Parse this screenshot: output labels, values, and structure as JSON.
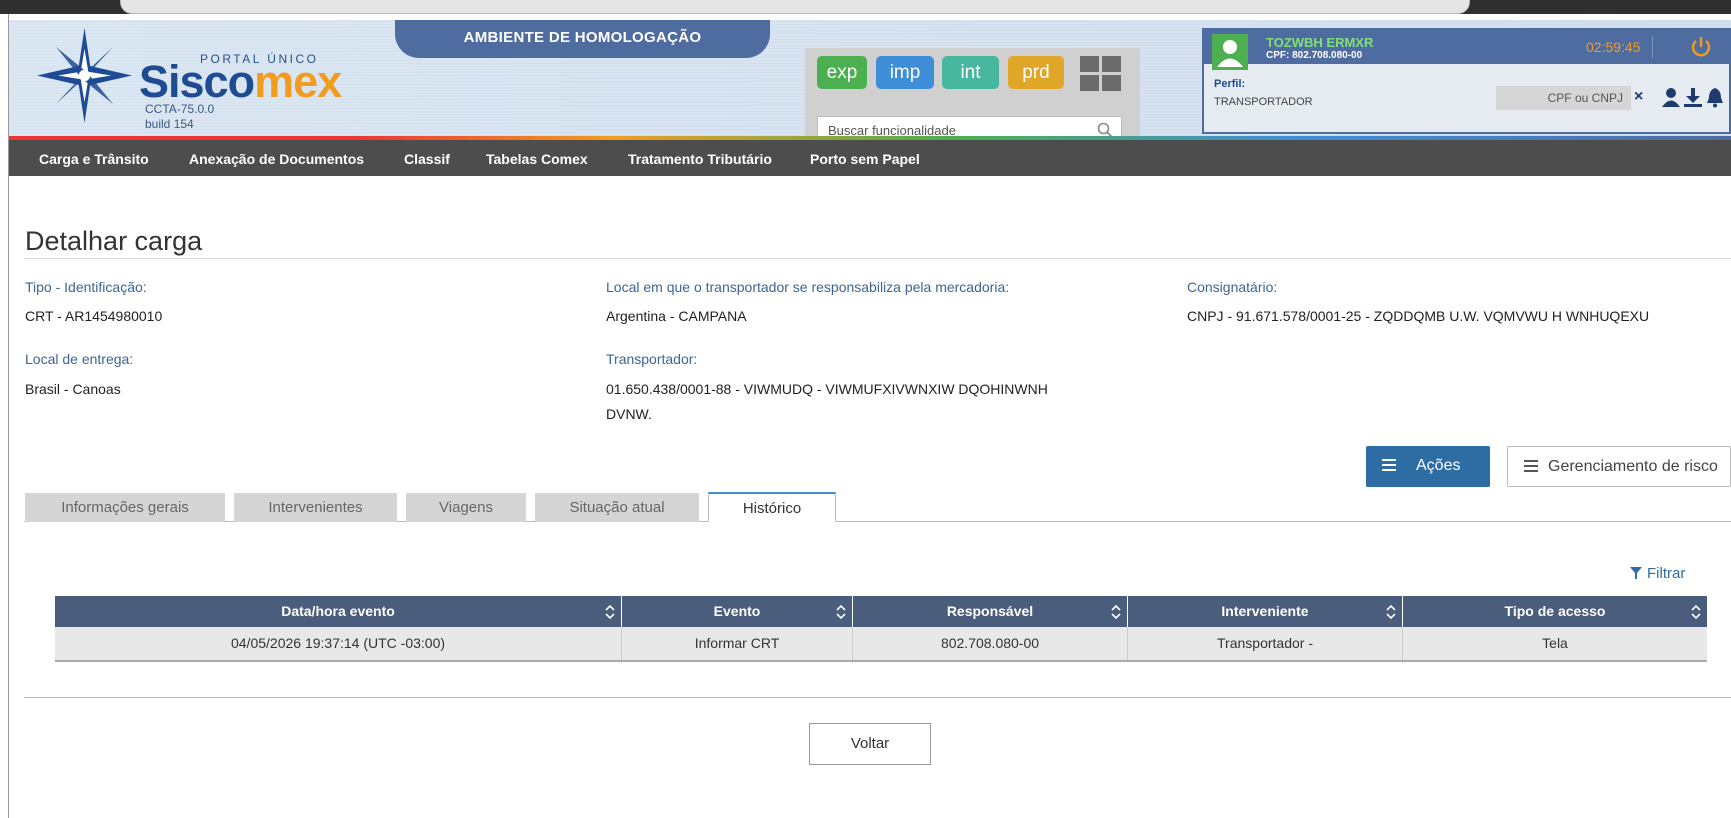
{
  "header": {
    "portal_label": "PORTAL ÚNICO",
    "brand_part1": "Sisco",
    "brand_part2": "mex",
    "version": "CCTA-75.0.0",
    "build": "build 154",
    "environment": "AMBIENTE DE HOMOLOGAÇÃO",
    "modules": [
      "exp",
      "imp",
      "int",
      "prd"
    ],
    "search_placeholder": "Buscar funcionalidade"
  },
  "user": {
    "name": "TOZWBH ERMXR",
    "cpf": "CPF: 802.708.080-00",
    "timer": "02:59:45",
    "perfil_label": "Perfil:",
    "perfil_value": "TRANSPORTADOR",
    "cpf_cnpj_placeholder": "CPF ou CNPJ"
  },
  "nav": [
    "Carga e Trânsito",
    "Anexação de Documentos",
    "Classif",
    "Tabelas Comex",
    "Tratamento Tributário",
    "Porto sem Papel"
  ],
  "page": {
    "title": "Detalhar carga",
    "fields": {
      "tipo_label": "Tipo - Identificação:",
      "tipo_value": "CRT - AR1454980010",
      "local_resp_label": "Local em que o transportador se responsabiliza pela mercadoria:",
      "local_resp_value": "Argentina - CAMPANA",
      "consig_label": "Consignatário:",
      "consig_value": "CNPJ - 91.671.578/0001-25 - ZQDDQMB U.W. VQMVWU H WNHUQEXU",
      "entrega_label": "Local de entrega:",
      "entrega_value": "Brasil - Canoas",
      "transp_label": "Transportador:",
      "transp_value_line1": "01.650.438/0001-88 - VIWMUDQ - VIWMUFXIVWNXIW DQOHINWNH",
      "transp_value_line2": "DVNW."
    },
    "actions": {
      "acoes": "Ações",
      "risco": "Gerenciamento de risco"
    },
    "tabs": [
      "Informações gerais",
      "Intervenientes",
      "Viagens",
      "Situação atual",
      "Histórico"
    ],
    "active_tab": "Histórico",
    "filter": "Filtrar",
    "table": {
      "headers": [
        "Data/hora evento",
        "Evento",
        "Responsável",
        "Interveniente",
        "Tipo de acesso"
      ],
      "rows": [
        [
          "04/05/2026 19:37:14 (UTC -03:00)",
          "Informar CRT",
          "802.708.080-00",
          "Transportador -",
          "Tela"
        ]
      ]
    },
    "back_button": "Voltar"
  },
  "colors": {
    "brand_blue": "#1f4b93",
    "brand_orange": "#f29c1f",
    "header_panel": "#4f6ca1",
    "nav_bg": "#4d4d4d",
    "primary_button": "#2e6da4",
    "table_header": "#4a5d7c"
  },
  "icons": [
    "star-logo-icon",
    "search-icon",
    "grid-apps-icon",
    "user-avatar-icon",
    "power-icon",
    "clear-icon",
    "person-icon",
    "download-icon",
    "bell-icon",
    "menu-icon",
    "filter-icon",
    "sort-icon"
  ]
}
